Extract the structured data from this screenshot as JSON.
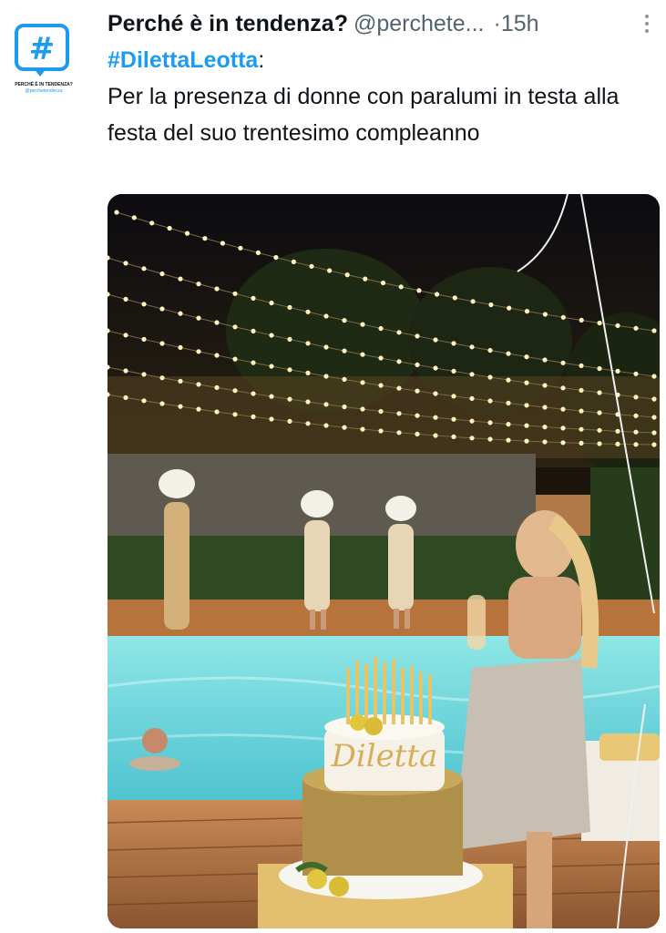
{
  "tweet": {
    "avatar": {
      "icon": "hashtag-bubble-icon",
      "caption": "PERCHÉ È IN TENDENZA?",
      "handle": "@perchetendenza"
    },
    "display_name": "Perché è in tendenza?",
    "handle": "@perchete...",
    "separator": "·",
    "timestamp": "15h",
    "more_icon": "more-vertical-icon",
    "hashtag": "#DilettaLeotta",
    "hashtag_suffix": ":",
    "text": "Per la presenza di donne con paralumi in testa alla festa del suo trentesimo compleanno",
    "media": {
      "cake_lettering": "Diletta"
    }
  },
  "colors": {
    "accent": "#1d9bf0",
    "text": "#0f1419",
    "secondary_text": "#536471"
  }
}
